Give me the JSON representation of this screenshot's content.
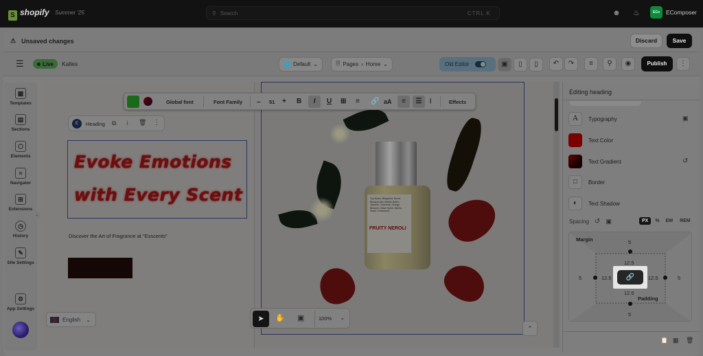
{
  "topbar": {
    "brand": "shopify",
    "season": "Summer '25",
    "search_placeholder": "Search",
    "shortcut": "CTRL  K",
    "store_initials": "EComposer",
    "store_name": "EComposer"
  },
  "unsaved": {
    "title": "Unsaved changes",
    "discard": "Discard",
    "save": "Save"
  },
  "toolbar": {
    "status": "Live",
    "theme": "Kalles",
    "template": "Default",
    "breadcrumb_pages": "Pages",
    "breadcrumb_home": "Home",
    "old_editor": "Old Editor",
    "publish": "Publish"
  },
  "rail": {
    "items": [
      {
        "label": "Templates",
        "icon": "grid-icon"
      },
      {
        "label": "Sections",
        "icon": "sections-icon"
      },
      {
        "label": "Elements",
        "icon": "cube-icon"
      },
      {
        "label": "Navigator",
        "icon": "list-icon"
      },
      {
        "label": "Extensions",
        "icon": "extensions-icon"
      },
      {
        "label": "History",
        "icon": "clock-icon"
      },
      {
        "label": "Site Settings",
        "icon": "brush-icon"
      }
    ],
    "app_settings": "App Settings"
  },
  "text_toolbar": {
    "global_font": "Global font",
    "font_family": "Font Family",
    "font_size": "51",
    "effects": "Effects"
  },
  "heading_chip": {
    "label": "Heading"
  },
  "canvas": {
    "heading_line1": "Evoke Emotions",
    "heading_line2": "with Every Scent",
    "subtext": "Discover the Art of Fragrance at \"Esscents\"",
    "label_text": "Top Notes: Bergamot, Neroli, Blackcurrant. Middle Notes: Jasmine, Tuberose, Orange Blossom. Base Notes: Vanilla, Musk, Cedarwood",
    "product_name": "FRUITY NEROLI",
    "language": "English",
    "zoom": "100%"
  },
  "panel": {
    "title": "Editing heading",
    "rows": [
      {
        "label": "Typography",
        "icon": "typography-icon"
      },
      {
        "label": "Text Color",
        "icon": "color-swatch"
      },
      {
        "label": "Text Gradient",
        "icon": "gradient-swatch"
      },
      {
        "label": "Border",
        "icon": "border-icon"
      },
      {
        "label": "Text Shadow",
        "icon": "shadow-icon"
      }
    ],
    "spacing_label": "Spacing",
    "units": [
      "PX",
      "%",
      "EM",
      "REM"
    ],
    "active_unit": "PX",
    "margin_label": "Margin",
    "padding_label": "Padding",
    "margin": {
      "top": "5",
      "right": "5",
      "bottom": "5",
      "left": "5"
    },
    "padding": {
      "top": "12.5",
      "right": "12.5",
      "bottom": "12.5",
      "left": "12.5"
    }
  },
  "colors": {
    "accent_green": "#0f8a3a",
    "heading_red": "#6a0f0f",
    "text_color_swatch": "#7a0000"
  }
}
